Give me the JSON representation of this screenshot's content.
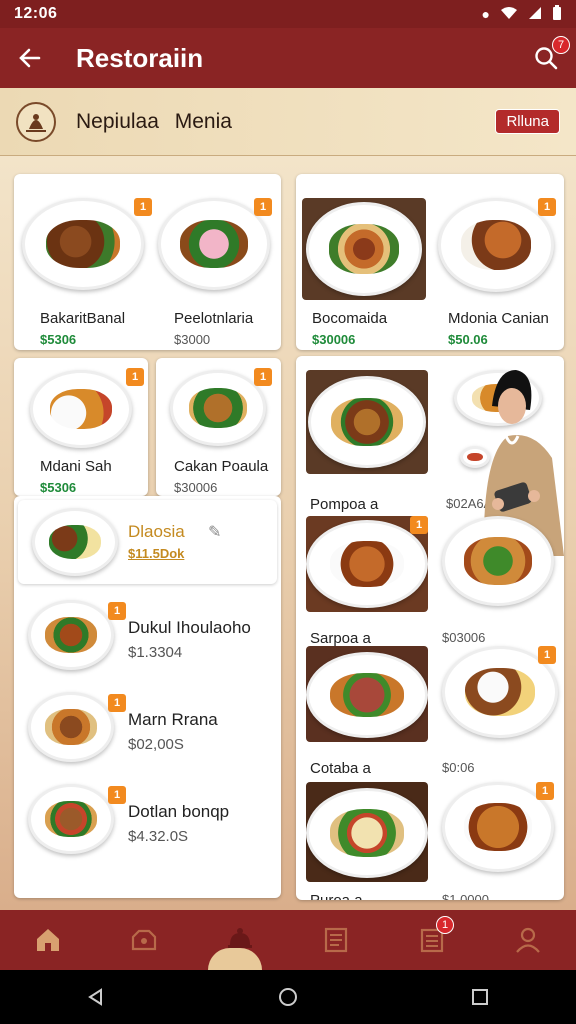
{
  "status_bar": {
    "time": "12:06"
  },
  "app_bar": {
    "title": "Restoraiin",
    "search_badge": "7"
  },
  "header": {
    "title": "Nepiulaa Menia",
    "pill": "Rlluna"
  },
  "grid": {
    "top_left": [
      {
        "name": "BakaritBanal",
        "price": "$5306",
        "tag": "1"
      },
      {
        "name": "Peelotnlaria",
        "price": "$3000",
        "tag": "1"
      }
    ],
    "top_right": [
      {
        "name": "Bocomaida",
        "price": "$30006",
        "tag": ""
      },
      {
        "name": "Mdonia Canian",
        "price": "$50.06",
        "tag": "1"
      }
    ],
    "mid_left": [
      {
        "name": "Mdani Sah",
        "price": "$5306",
        "tag": "1"
      },
      {
        "name": "Cakan Poaula",
        "price": "$30006",
        "tag": "1"
      }
    ],
    "featured": {
      "name": "Dlaosia",
      "price": "$11.5Dok"
    },
    "list": [
      {
        "name": "Dukul Ihoulaoho",
        "price": "$1.3304",
        "tag": "1"
      },
      {
        "name": "Marn Rrana",
        "price": "$02,00S",
        "tag": "1"
      },
      {
        "name": "Dotlan bonqp",
        "price": "$4.32.0S",
        "tag": "1"
      }
    ],
    "right_column": [
      {
        "name": "Pompoa a",
        "price": "$02A6AS",
        "tag": ""
      },
      {
        "name": "Sarpoa a",
        "price": "$03006",
        "tag": "1"
      },
      {
        "name": "Cotaba a",
        "price": "$0:06",
        "tag": "1"
      },
      {
        "name": "Puroa a",
        "price": "$1.0000",
        "tag": "1"
      }
    ]
  },
  "bottom_nav": {
    "items": [
      "home-icon",
      "store-icon",
      "cloche-icon",
      "menu-book-icon",
      "receipt-icon",
      "profile-icon"
    ],
    "receipt_badge": "1"
  },
  "colors": {
    "primary": "#8a2424",
    "accent": "#f28a1f",
    "price_green": "#1f8b3a"
  }
}
